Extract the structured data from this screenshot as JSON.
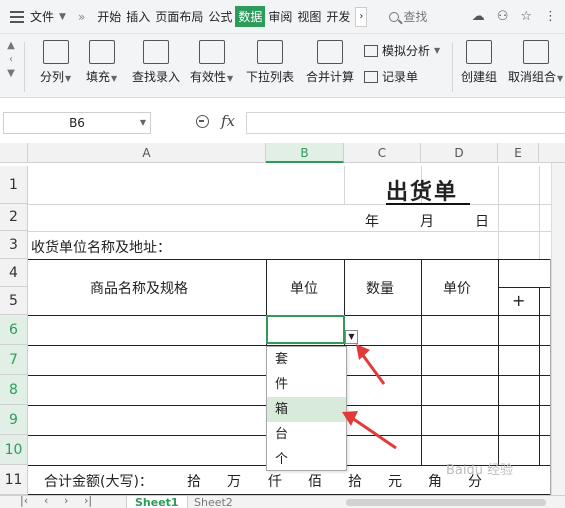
{
  "menubar": {
    "file_label": "文件",
    "tabs": [
      {
        "label": "开始"
      },
      {
        "label": "插入"
      },
      {
        "label": "页面布局"
      },
      {
        "label": "公式"
      },
      {
        "label": "数据",
        "active": true
      },
      {
        "label": "审阅"
      },
      {
        "label": "视图"
      },
      {
        "label": "开发"
      }
    ],
    "search_label": "查找"
  },
  "ribbon": {
    "split": "分列",
    "fill": "填充",
    "lookup": "查找录入",
    "validity": "有效性",
    "dropdown_list": "下拉列表",
    "consolidate": "合并计算",
    "whatif": "模拟分析",
    "record": "记录单",
    "group": "创建组",
    "ungroup": "取消组合"
  },
  "formula_bar": {
    "name_box": "B6",
    "fx": "fx",
    "value": ""
  },
  "columns": [
    "A",
    "B",
    "C",
    "D",
    "E"
  ],
  "rows": [
    "1",
    "2",
    "3",
    "4",
    "5",
    "6",
    "7",
    "8",
    "9",
    "10",
    "11"
  ],
  "sheet": {
    "title": "出货单",
    "year": "年",
    "month": "月",
    "day": "日",
    "customer_label": "收货单位名称及地址：",
    "header_product": "商品名称及规格",
    "header_unit": "单位",
    "header_qty": "数量",
    "header_price": "单价",
    "plus": "+",
    "total_label": "合计金额(大写)：",
    "total_units": [
      "拾",
      "万",
      "仟",
      "佰",
      "拾",
      "元",
      "角",
      "分"
    ]
  },
  "dropdown": {
    "options": [
      "套",
      "件",
      "箱",
      "台",
      "个"
    ],
    "highlighted": "箱"
  },
  "tabs": {
    "active": "Sheet1",
    "other": "Sheet2"
  },
  "watermark": "Baidu 经验",
  "colors": {
    "accent": "#2e9b5a",
    "arrow": "#e03b3b"
  }
}
